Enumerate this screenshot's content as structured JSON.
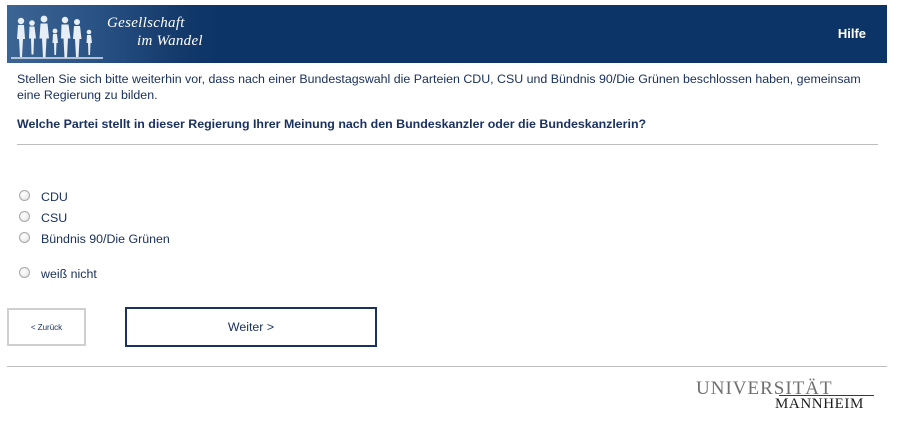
{
  "header": {
    "brand_line1": "Gesellschaft",
    "brand_line2": "im Wandel",
    "help_label": "Hilfe"
  },
  "survey": {
    "intro": "Stellen Sie sich bitte weiterhin vor, dass nach einer Bundestagswahl die Parteien CDU, CSU und Bündnis 90/Die Grünen beschlossen haben, gemeinsam eine Regierung zu bilden.",
    "question": "Welche Partei stellt in dieser Regierung Ihrer Meinung nach den Bundeskanzler oder die Bundeskanzlerin?",
    "options": [
      {
        "label": "CDU",
        "selected": false
      },
      {
        "label": "CSU",
        "selected": false
      },
      {
        "label": "Bündnis 90/Die Grünen",
        "selected": false
      },
      {
        "label": "weiß nicht",
        "selected": false
      }
    ]
  },
  "nav": {
    "back_label": "< Zurück",
    "next_label": "Weiter >"
  },
  "footer": {
    "logo_line1": "UNIVERSITÄT",
    "logo_line2": "MANNHEIM"
  },
  "colors": {
    "header_bg": "#0c3466",
    "text": "#1b3160",
    "button_border": "#1b3160"
  }
}
